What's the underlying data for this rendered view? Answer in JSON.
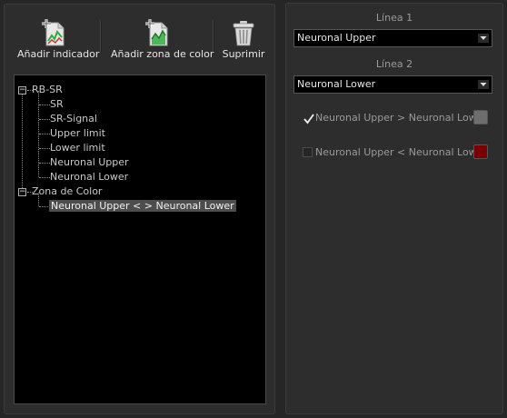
{
  "toolbar": {
    "add_indicator_label": "Añadir indicador",
    "add_color_zone_label": "Añadir zona de color",
    "delete_label": "Suprimir"
  },
  "tree": {
    "root_indicator": "RB-SR",
    "indicator_children": [
      "SR",
      "SR-Signal",
      "Upper limit",
      "Lower limit",
      "Neuronal Upper",
      "Neuronal Lower"
    ],
    "root_zone": "Zona de Color",
    "zone_children": [
      "Neuronal Upper < > Neuronal Lower"
    ],
    "expander_symbol": "−"
  },
  "right": {
    "line1_label": "Línea 1",
    "line1_value": "Neuronal Upper",
    "line2_label": "Línea 2",
    "line2_value": "Neuronal Lower",
    "condition_above": {
      "text": "Neuronal Upper > Neuronal Lower",
      "checked": true,
      "color": "#6e6e6e"
    },
    "condition_below": {
      "text": "Neuronal Upper < Neuronal Lower",
      "checked": false,
      "color": "#7a0000"
    }
  }
}
